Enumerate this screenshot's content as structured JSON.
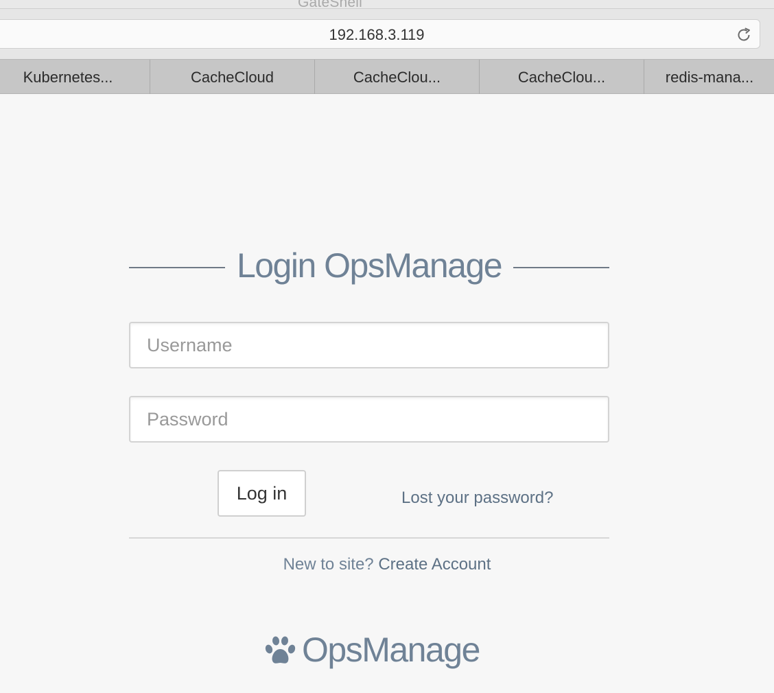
{
  "window": {
    "title": "GateShell"
  },
  "address_bar": {
    "url": "192.168.3.119",
    "reload_icon": "reload-icon"
  },
  "tabs": [
    {
      "label": "Kubernetes..."
    },
    {
      "label": "CacheCloud"
    },
    {
      "label": "CacheClou..."
    },
    {
      "label": "CacheClou..."
    },
    {
      "label": "redis-mana..."
    }
  ],
  "login": {
    "title": "Login OpsManage",
    "username_placeholder": "Username",
    "password_placeholder": "Password",
    "login_button": "Log in",
    "lost_password": "Lost your password?",
    "signup_prefix": "New to site?",
    "signup_link": "Create Account"
  },
  "brand": {
    "name": "OpsManage",
    "icon": "paw-icon"
  },
  "colors": {
    "accent": "#6f8296",
    "link": "#5d7185",
    "background": "#f7f7f7"
  }
}
